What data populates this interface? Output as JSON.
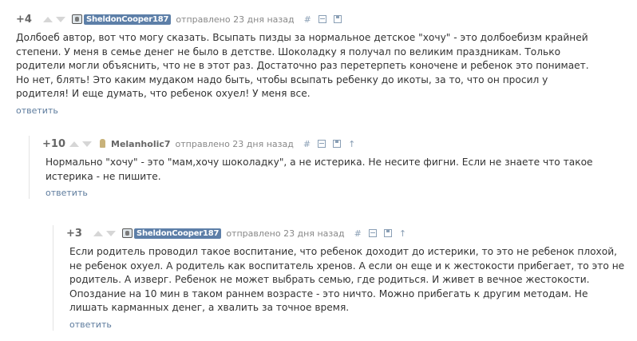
{
  "comments": [
    {
      "rating": "+4",
      "username": "SheldonCooper187",
      "meta": "отправлено 23 дня назад",
      "anchor_symbol": "#",
      "lines": [
        "Долбоеб автор, вот что могу сказать. Всыпать пизды за нормальное детское \"хочу\" - это долбоебизм крайней",
        "степени. У меня в семье денег не было в детстве. Шоколадку я получал по великим праздникам. Только",
        "родители могли объяснить, что не в этот раз. Достаточно раз перетерпеть коночене и ребенок это понимает.",
        "Но нет, блять! Это каким мудаком надо быть, чтобы всыпать ребенку до икоты, за то, что он просил у",
        "родителя! И еще думать, что ребенок охуел! У меня все."
      ],
      "reply_label": "ответить"
    },
    {
      "rating": "+10",
      "username": "Melanholic7",
      "meta": "отправлено 23 дня назад",
      "anchor_symbol": "#",
      "parent_symbol": "↑",
      "lines": [
        "Нормально \"хочу\" - это \"мам,хочу шоколадку\", а не истерика. Не несите фигни. Если не знаете что такое",
        "истерика - не пишите."
      ],
      "reply_label": "ответить"
    },
    {
      "rating": "+3",
      "username": "SheldonCooper187",
      "meta": "отправлено 23 дня назад",
      "anchor_symbol": "#",
      "parent_symbol": "↑",
      "lines": [
        "Если родитель проводил такое воспитание, что ребенок доходит до истерики, то это не ребенок плохой,",
        "не ребенок охуел. А родитель как воспитатель хренов. А если он еще и к жестокости прибегает, то это не",
        "родитель. А изверг. Ребенок не может выбрать семью, где родиться. И живет в вечное жестокости.",
        "Опоздание на 10 мин в таком раннем возрасте - это ничто. Можно прибегать к другим методам. Не",
        "лишать карманных денег, а хвалить за точное время."
      ],
      "reply_label": "ответить"
    }
  ],
  "colors": {
    "badge": "#5d7fa8",
    "link": "#5e7c9e",
    "text": "#333333"
  }
}
